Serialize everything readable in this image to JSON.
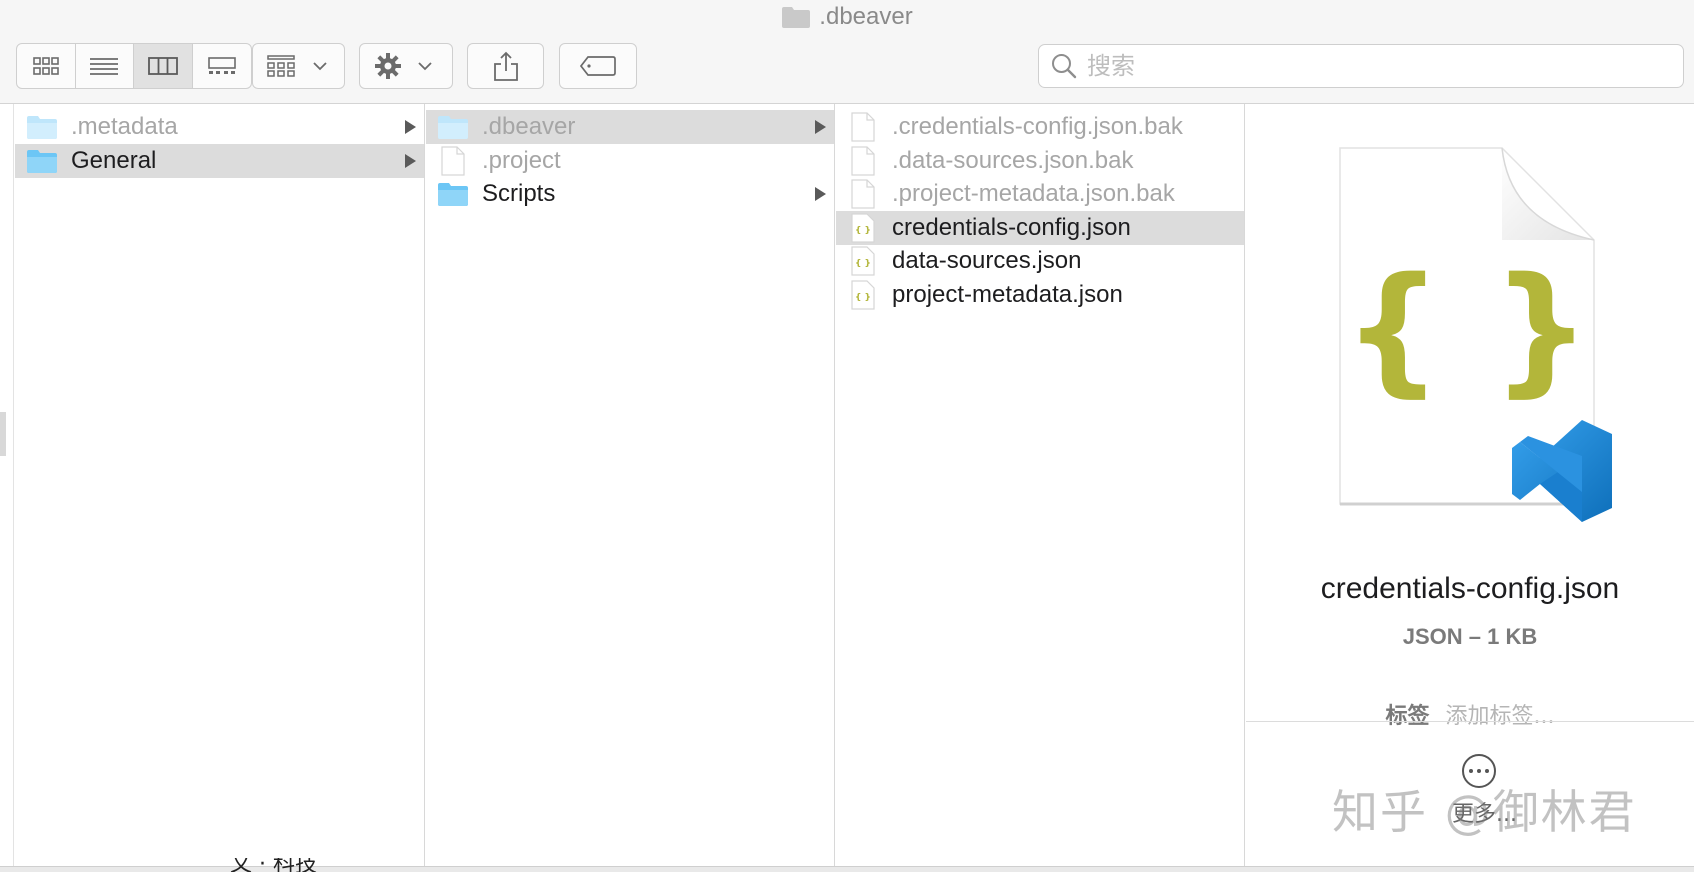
{
  "window": {
    "title": ".dbeaver"
  },
  "toolbar": {
    "view_modes": [
      "icon-view",
      "list-view",
      "column-view",
      "gallery-view"
    ],
    "active_view": "column-view",
    "group_by_icon": "group-grid-icon",
    "action_icon": "gear-icon",
    "share_icon": "share-icon",
    "tag_icon": "tag-icon"
  },
  "search": {
    "placeholder": "搜索",
    "value": ""
  },
  "columns": {
    "col1": [
      {
        "label": ".metadata",
        "type": "folder",
        "dim": true,
        "selected": false,
        "has_children": true
      },
      {
        "label": "General",
        "type": "folder",
        "dim": false,
        "selected": true,
        "has_children": true
      }
    ],
    "col2": [
      {
        "label": ".dbeaver",
        "type": "folder",
        "dim": true,
        "selected": true,
        "has_children": true
      },
      {
        "label": ".project",
        "type": "file",
        "dim": true,
        "selected": false,
        "has_children": false
      },
      {
        "label": "Scripts",
        "type": "folder",
        "dim": false,
        "selected": false,
        "has_children": true
      }
    ],
    "col3": [
      {
        "label": ".credentials-config.json.bak",
        "type": "file",
        "dim": true,
        "selected": false
      },
      {
        "label": ".data-sources.json.bak",
        "type": "file",
        "dim": true,
        "selected": false
      },
      {
        "label": ".project-metadata.json.bak",
        "type": "file",
        "dim": true,
        "selected": false
      },
      {
        "label": "credentials-config.json",
        "type": "json",
        "dim": false,
        "selected": true
      },
      {
        "label": "data-sources.json",
        "type": "json",
        "dim": false,
        "selected": false
      },
      {
        "label": "project-metadata.json",
        "type": "json",
        "dim": false,
        "selected": false
      }
    ]
  },
  "preview": {
    "file_name": "credentials-config.json",
    "kind_size": "JSON – 1 KB",
    "tags_label": "标签",
    "tags_placeholder": "添加标签...",
    "more_label": "更多..."
  },
  "colors": {
    "folder": "#6cc6f5",
    "selection": "#dcdcdc",
    "json_brace": "#b3b63a",
    "vscode_blue": "#1f8ad2"
  },
  "watermark": "知乎 @御林君",
  "bottom_partial_text": "文 · 科技"
}
